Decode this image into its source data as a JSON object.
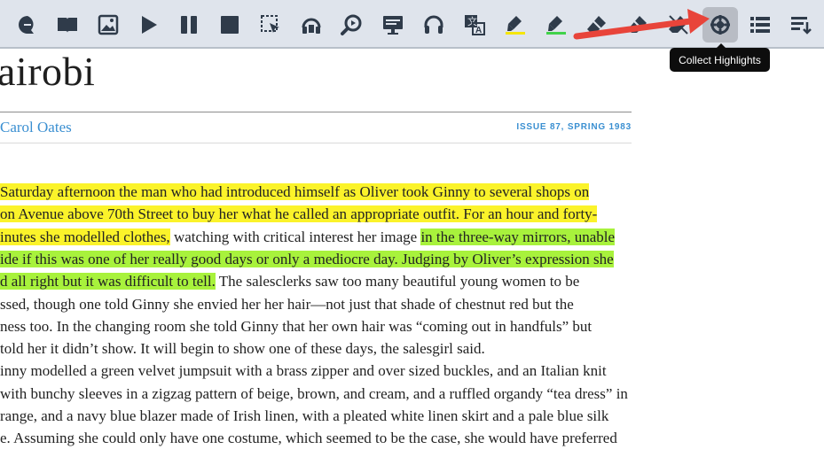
{
  "toolbar": {
    "buttons": [
      {
        "name": "talk-bubble-icon"
      },
      {
        "name": "book-icon"
      },
      {
        "name": "image-icon"
      },
      {
        "name": "play-icon"
      },
      {
        "name": "pause-icon"
      },
      {
        "name": "stop-icon"
      },
      {
        "name": "click-speak-icon"
      },
      {
        "name": "speaker-headset-icon"
      },
      {
        "name": "zoom-voice-icon"
      },
      {
        "name": "screen-icon"
      },
      {
        "name": "headphones-icon"
      },
      {
        "name": "translate-icon"
      },
      {
        "name": "highlight-yellow-icon",
        "color": "#f5e60a"
      },
      {
        "name": "highlight-green-icon",
        "color": "#41d24a"
      },
      {
        "name": "eraser-icon"
      },
      {
        "name": "eraser-icon"
      },
      {
        "name": "clear-icon"
      },
      {
        "name": "collect-highlights-icon",
        "active": true
      },
      {
        "name": "list-icon"
      },
      {
        "name": "sort-list-icon"
      }
    ],
    "tooltip": "Collect Highlights"
  },
  "article": {
    "title": "airobi",
    "author": "Carol Oates",
    "issue": "ISSUE 87, SPRING 1983",
    "lines": [
      {
        "segments": [
          {
            "text": "Saturday afternoon the man who had introduced himself as Oliver took Ginny to several shops on",
            "hl": "yellow"
          }
        ]
      },
      {
        "segments": [
          {
            "text": "on Avenue above 70th Street to buy her what he called an appropriate outfit. For an hour and forty-",
            "hl": "yellow"
          }
        ]
      },
      {
        "segments": [
          {
            "text": "inutes she modelled clothes,",
            "hl": "yellow"
          },
          {
            "text": " watching with critical interest her image ",
            "hl": ""
          },
          {
            "text": "in the three-way mirrors, unable",
            "hl": "green"
          }
        ]
      },
      {
        "segments": [
          {
            "text": "ide if this was one of her really good days or only a mediocre day. Judging by Oliver’s expression she",
            "hl": "green"
          }
        ]
      },
      {
        "segments": [
          {
            "text": "d all right but it was difficult to tell.",
            "hl": "green"
          },
          {
            "text": " The salesclerks saw too many beautiful young women to be",
            "hl": ""
          }
        ]
      },
      {
        "segments": [
          {
            "text": "ssed, though one told Ginny she envied her her hair—not just that shade of chestnut red but the",
            "hl": ""
          }
        ]
      },
      {
        "segments": [
          {
            "text": "ness too. In the changing room she told Ginny that her own hair was “coming out in handfuls” but",
            "hl": ""
          }
        ]
      },
      {
        "segments": [
          {
            "text": " told her it didn’t show. It will begin to show one of these days, the salesgirl said.",
            "hl": ""
          }
        ]
      },
      {
        "segments": [
          {
            "text": "inny modelled a green velvet jumpsuit with a brass zipper and over sized buckles, and an Italian knit",
            "hl": ""
          }
        ]
      },
      {
        "segments": [
          {
            "text": "with bunchy sleeves in a zigzag pattern of beige, brown, and cream, and a ruffled organdy “tea dress” in",
            "hl": ""
          }
        ]
      },
      {
        "segments": [
          {
            "text": "range, and a navy blue blazer made of Irish linen, with a pleated white linen skirt and a pale blue silk",
            "hl": ""
          }
        ]
      },
      {
        "segments": [
          {
            "text": "e. Assuming she could only have one costume, which seemed to be the case, she would have preferred",
            "hl": ""
          }
        ]
      }
    ]
  },
  "colors": {
    "highlight_yellow": "#fbf32a",
    "highlight_green": "#a8f23c",
    "accent_blue": "#3a8fd1",
    "annotation_arrow": "#e8443a"
  }
}
